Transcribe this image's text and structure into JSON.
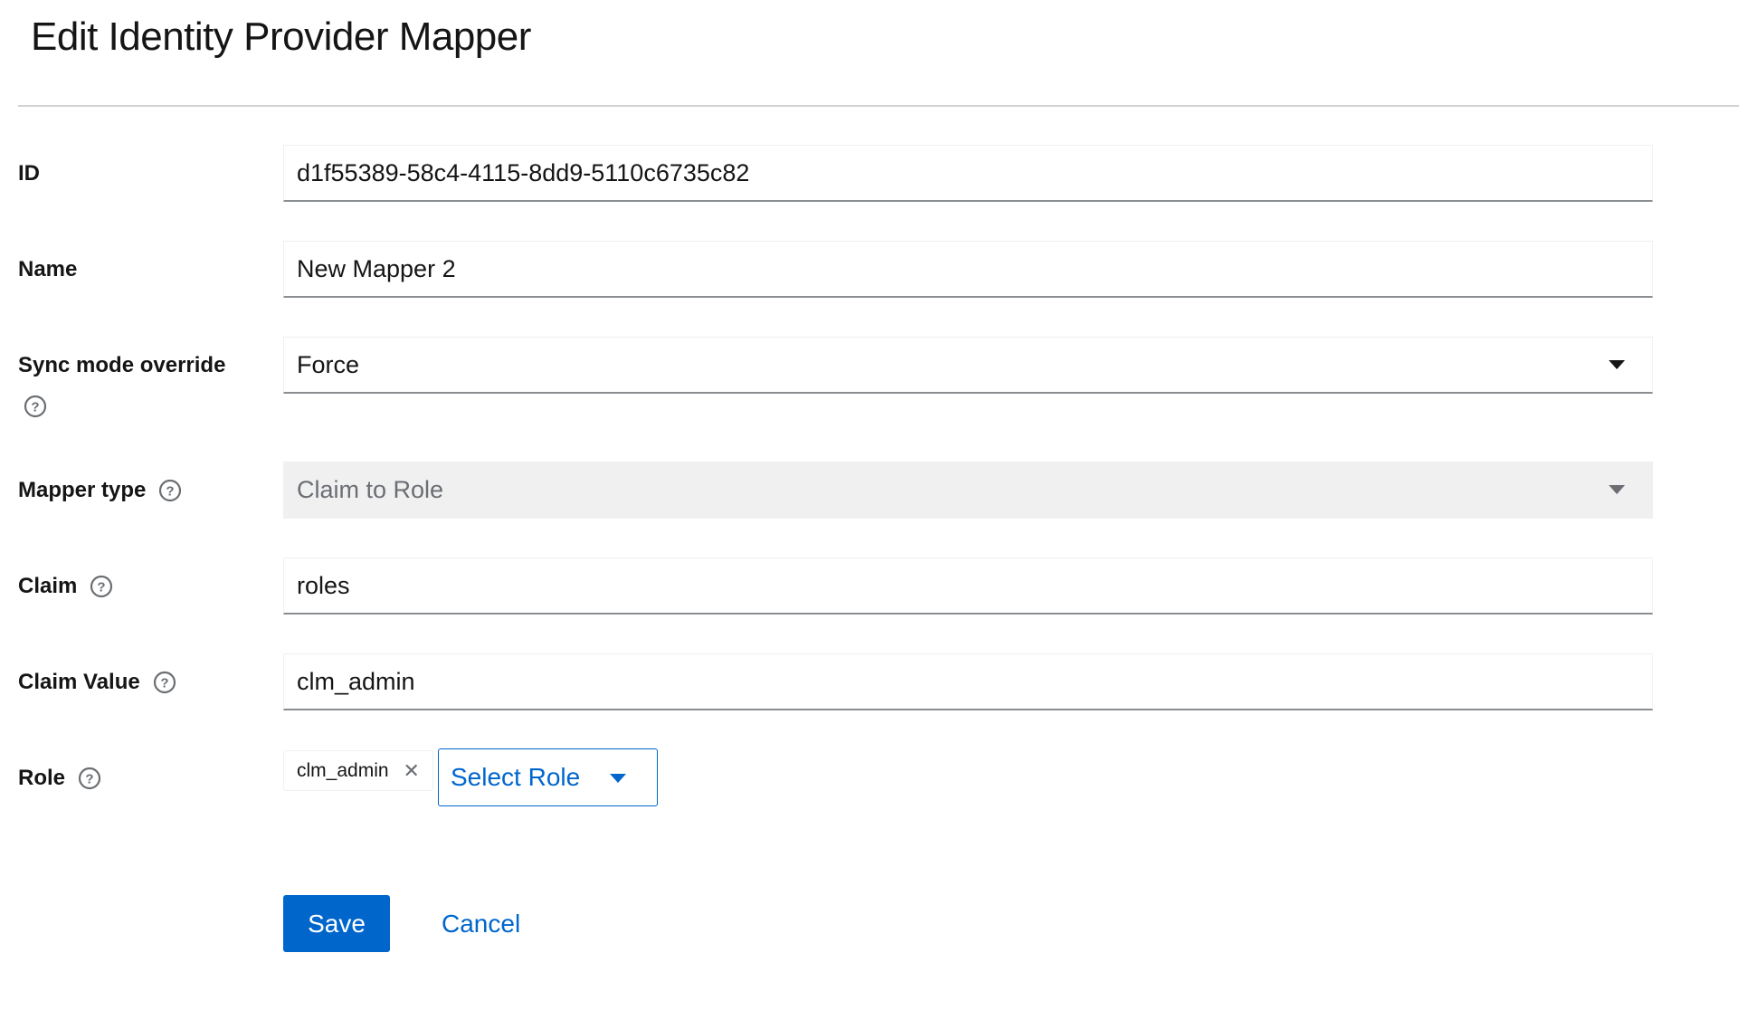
{
  "page": {
    "title": "Edit Identity Provider Mapper"
  },
  "fields": {
    "id": {
      "label": "ID",
      "value": "d1f55389-58c4-4115-8dd9-5110c6735c82"
    },
    "name": {
      "label": "Name",
      "value": "New Mapper 2"
    },
    "sync_mode": {
      "label": "Sync mode override",
      "value": "Force",
      "help_icon": "question-circle-icon"
    },
    "mapper_type": {
      "label": "Mapper type",
      "value": "Claim to Role",
      "disabled": true,
      "help_icon": "question-circle-icon"
    },
    "claim": {
      "label": "Claim",
      "value": "roles",
      "help_icon": "question-circle-icon"
    },
    "claim_value": {
      "label": "Claim Value",
      "value": "clm_admin",
      "help_icon": "question-circle-icon"
    },
    "role": {
      "label": "Role",
      "help_icon": "question-circle-icon",
      "chip": "clm_admin",
      "select_label": "Select Role"
    }
  },
  "actions": {
    "save_label": "Save",
    "cancel_label": "Cancel"
  },
  "colors": {
    "accent": "#0066cc",
    "text": "#151515",
    "disabled_bg": "#f0f0f0",
    "divider": "#d2d2d2"
  }
}
